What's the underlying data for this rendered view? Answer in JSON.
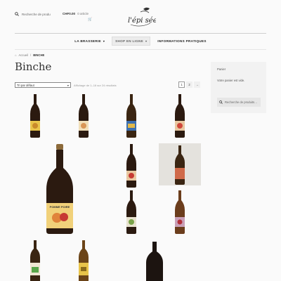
{
  "header": {
    "search_placeholder": "Recherche de produ",
    "cart_amount": "CHF0.00",
    "cart_count": "0 article",
    "logo_text": "l'épi sée"
  },
  "nav": {
    "items": [
      {
        "label": "LA BRASSERIE"
      },
      {
        "label": "SHOP EN LIGNE"
      },
      {
        "label": "INFORMATIONS PRATIQUES"
      }
    ]
  },
  "breadcrumb": {
    "home": "Accueil",
    "separator": "/",
    "current": "BINCHE"
  },
  "page_title": "Binche",
  "toolbar": {
    "sort_label": "Tri par défaut",
    "result_count": "Affichage de 1–16 sur 24 résultats",
    "pages": [
      "1",
      "2",
      "→"
    ]
  },
  "sidebar": {
    "cart_title": "Panier",
    "cart_empty": "Votre panier est vide.",
    "search_placeholder": "Recherche de produits…"
  },
  "products": [
    {
      "name": "bottle-yellow-label"
    },
    {
      "name": "bottle-peach-label"
    },
    {
      "name": "bottle-blue-label"
    },
    {
      "name": "bottle-red-label"
    },
    {
      "name": "bottle-large-pomme-poire"
    },
    {
      "name": "bottle-apple-label"
    },
    {
      "name": "bottle-photo-red-label"
    },
    {
      "name": "bottle-green-label"
    },
    {
      "name": "bottle-amber-red-label"
    },
    {
      "name": "bottle-short-green-label"
    },
    {
      "name": "bottle-short-gold-label"
    },
    {
      "name": "bottle-short-dark"
    }
  ],
  "large_label_text": "POMME POIRE",
  "colors": {
    "accent": "#96588a",
    "bottle_dark": "#2a1d14",
    "label_yellow": "#e8c44a",
    "label_blue": "#3b6fb0",
    "label_red": "#d0473a"
  }
}
